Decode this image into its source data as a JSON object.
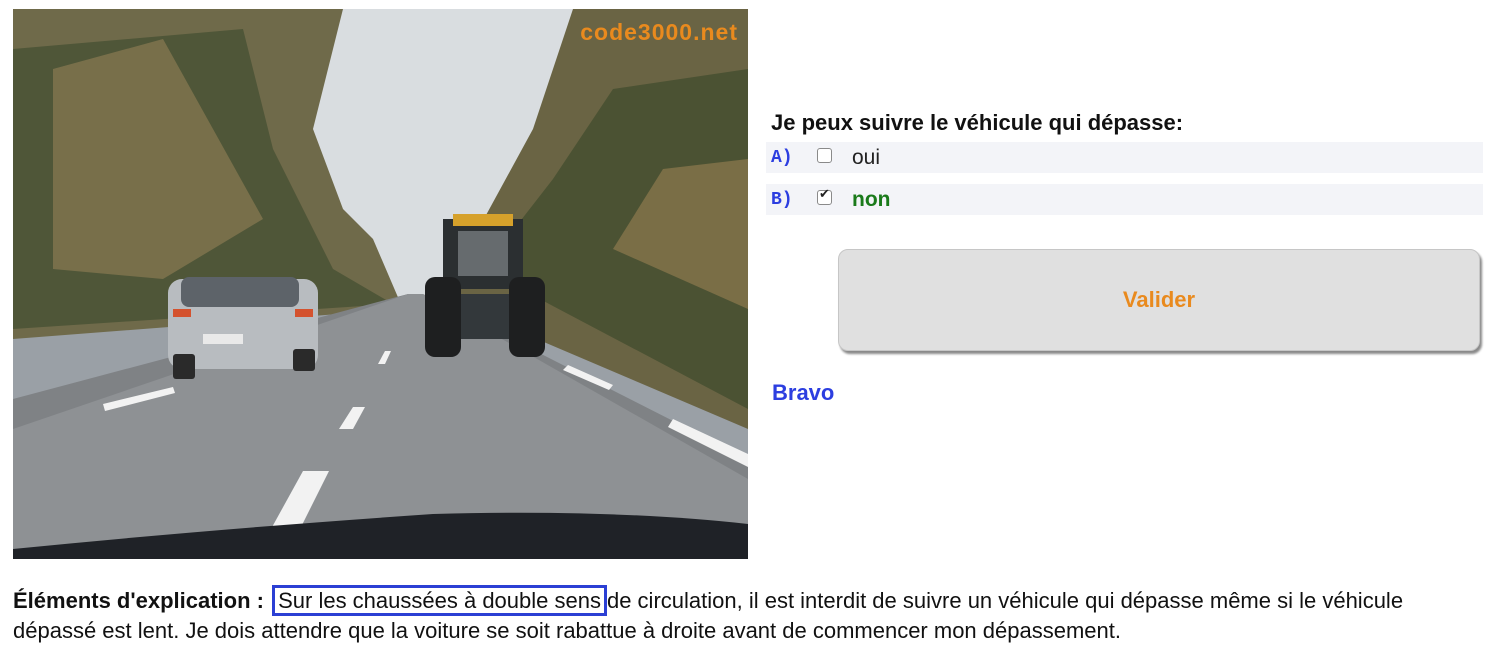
{
  "photo": {
    "watermark": "code3000.net",
    "alt": "Route à double sens: une voiture dépasse un tracteur"
  },
  "quiz": {
    "question": "Je peux suivre le véhicule qui dépasse:",
    "answers": [
      {
        "letter": "A)",
        "text": "oui",
        "checked": false
      },
      {
        "letter": "B)",
        "text": "non",
        "checked": true
      }
    ],
    "validate_label": "Valider",
    "result": "Bravo"
  },
  "explanation": {
    "label": "Éléments d'explication :",
    "highlight": "Sur les chaussées à double sens",
    "rest": "de circulation, il est interdit de suivre un véhicule qui dépasse même si le véhicule dépassé est lent. Je dois attendre que la voiture se soit rabattue à droite avant de commencer mon dépassement."
  },
  "colors": {
    "accent_orange": "#e98a1e",
    "accent_blue": "#2c3ee0",
    "correct_green": "#1a7a1a"
  }
}
